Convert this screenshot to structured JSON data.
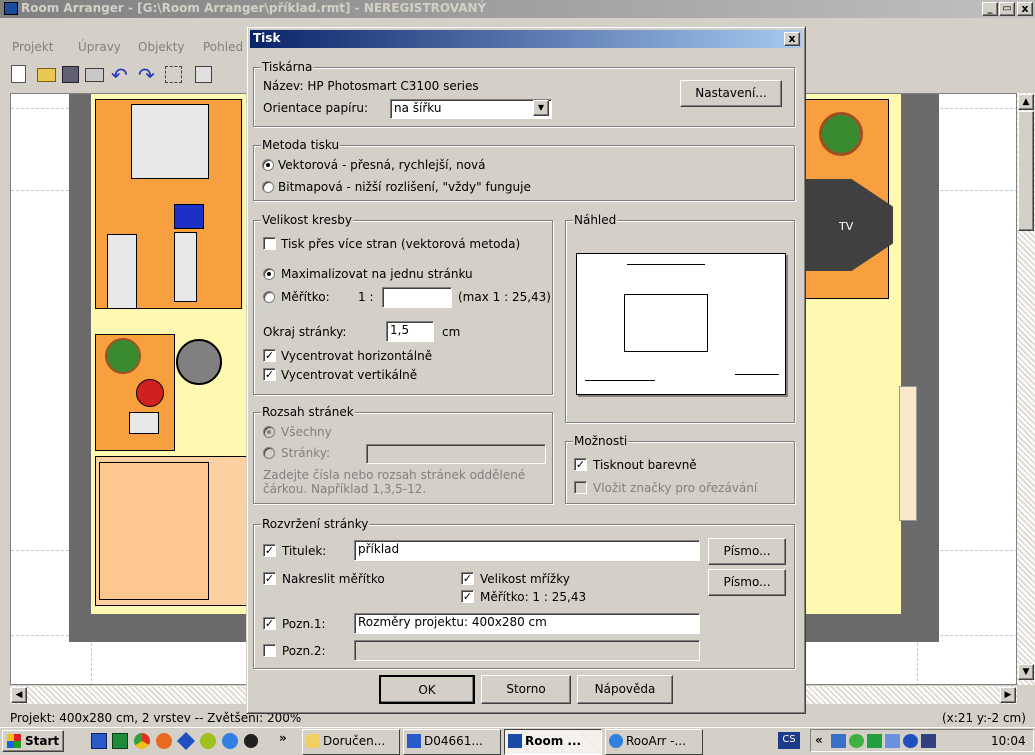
{
  "main_window": {
    "title": "Room Arranger - [G:\\Room Arranger\\příklad.rmt] - NEREGISTROVANÝ",
    "menu": [
      "Projekt",
      "Úpravy",
      "Objekty",
      "Pohled"
    ],
    "window_controls": [
      "_",
      "🗗",
      "x"
    ],
    "tv_label": "TV",
    "status_left": "Projekt: 400x280 cm, 2 vrstev -- Zvětšení: 200%",
    "status_right": "(x:21 y:-2 cm)"
  },
  "dialog": {
    "title": "Tisk",
    "close": "x",
    "printer": {
      "group_label": "Tiskárna",
      "name": "Název: HP Photosmart C3100 series",
      "orientation_label": "Orientace papíru:",
      "orientation_value": "na šířku",
      "settings_button": "Nastavení..."
    },
    "method": {
      "group_label": "Metoda tisku",
      "vector": "Vektorová - přesná, rychlejší, nová",
      "bitmap": "Bitmapová - nižší rozlišení, \"vždy\" funguje"
    },
    "size": {
      "group_label": "Velikost kresby",
      "multi_page": "Tisk přes více stran (vektorová metoda)",
      "maximize": "Maximalizovat na jednu stránku",
      "scale_label": "Měřítko:",
      "scale_prefix": "1 :",
      "scale_value": "",
      "scale_max": "(max 1 : 25,43)",
      "margin_label": "Okraj stránky:",
      "margin_value": "1,5",
      "margin_unit": "cm",
      "center_h": "Vycentrovat horizontálně",
      "center_v": "Vycentrovat vertikálně"
    },
    "preview": {
      "group_label": "Náhled"
    },
    "range": {
      "group_label": "Rozsah stránek",
      "all": "Všechny",
      "pages": "Stránky:",
      "pages_value": "",
      "hint": "Zadejte čísla nebo rozsah stránek oddělené čárkou. Například 1,3,5-12."
    },
    "options": {
      "group_label": "Možnosti",
      "color": "Tisknout barevně",
      "crop_marks": "Vložit značky pro ořezávání"
    },
    "layout": {
      "group_label": "Rozvržení stránky",
      "title_label": "Titulek:",
      "title_value": "příklad",
      "font_button_1": "Písmo...",
      "draw_scale": "Nakreslit měřítko",
      "grid_size": "Velikost mřížky",
      "scale_text": "Měřítko: 1 : 25,43",
      "font_button_2": "Písmo...",
      "note1_label": "Pozn.1:",
      "note1_value": "Rozměry projektu: 400x280 cm",
      "note2_label": "Pozn.2:",
      "note2_value": ""
    },
    "buttons": {
      "ok": "OK",
      "cancel": "Storno",
      "help": "Nápověda"
    }
  },
  "taskbar": {
    "start": "Start",
    "chevron": "»",
    "tasks": [
      "Doručen...",
      "D04661...",
      "Room ...",
      "RooArr -..."
    ],
    "lang": "CS",
    "tray_chevron": "«",
    "clock": "10:04"
  },
  "colors": {
    "title_active": "#0a246a",
    "title_gradient": "#a6caf0",
    "dialog_bg": "#d4d0c8",
    "room_floor": "#fff8b0",
    "furniture": "#f8a040"
  }
}
